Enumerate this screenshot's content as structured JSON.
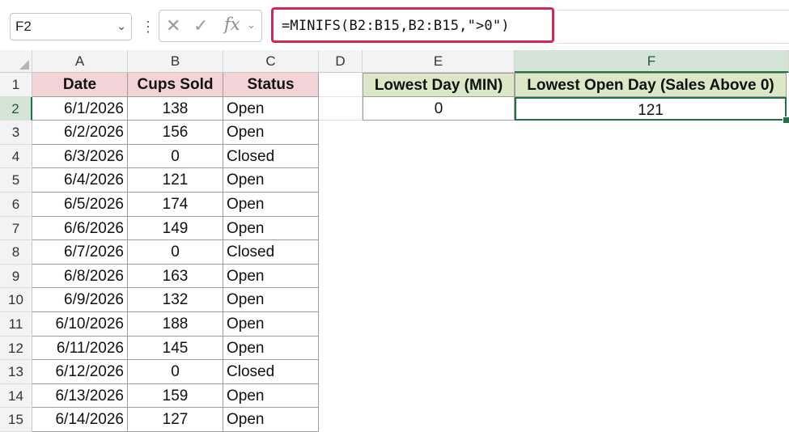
{
  "name_box": {
    "value": "F2"
  },
  "formula_bar": {
    "fx_label": "fx",
    "formula": "=MINIFS(B2:B15,B2:B15,\">0\")"
  },
  "columns": [
    "A",
    "B",
    "C",
    "D",
    "E",
    "F"
  ],
  "rows": [
    "1",
    "2",
    "3",
    "4",
    "5",
    "6",
    "7",
    "8",
    "9",
    "10",
    "11",
    "12",
    "13",
    "14",
    "15"
  ],
  "table": {
    "headers": [
      "Date",
      "Cups Sold",
      "Status"
    ],
    "rows": [
      [
        "6/1/2026",
        "138",
        "Open"
      ],
      [
        "6/2/2026",
        "156",
        "Open"
      ],
      [
        "6/3/2026",
        "0",
        "Closed"
      ],
      [
        "6/4/2026",
        "121",
        "Open"
      ],
      [
        "6/5/2026",
        "174",
        "Open"
      ],
      [
        "6/6/2026",
        "149",
        "Open"
      ],
      [
        "6/7/2026",
        "0",
        "Closed"
      ],
      [
        "6/8/2026",
        "163",
        "Open"
      ],
      [
        "6/9/2026",
        "132",
        "Open"
      ],
      [
        "6/10/2026",
        "188",
        "Open"
      ],
      [
        "6/11/2026",
        "145",
        "Open"
      ],
      [
        "6/12/2026",
        "0",
        "Closed"
      ],
      [
        "6/13/2026",
        "159",
        "Open"
      ],
      [
        "6/14/2026",
        "127",
        "Open"
      ]
    ]
  },
  "summary": {
    "headers": [
      "Lowest Day (MIN)",
      "Lowest Open Day (Sales Above 0)"
    ],
    "values": [
      "0",
      "121"
    ]
  },
  "colors": {
    "accent": "#217346",
    "highlight_border": "#d42755",
    "header_pink": "#f2d4d8",
    "header_green": "#dbe7c7"
  }
}
